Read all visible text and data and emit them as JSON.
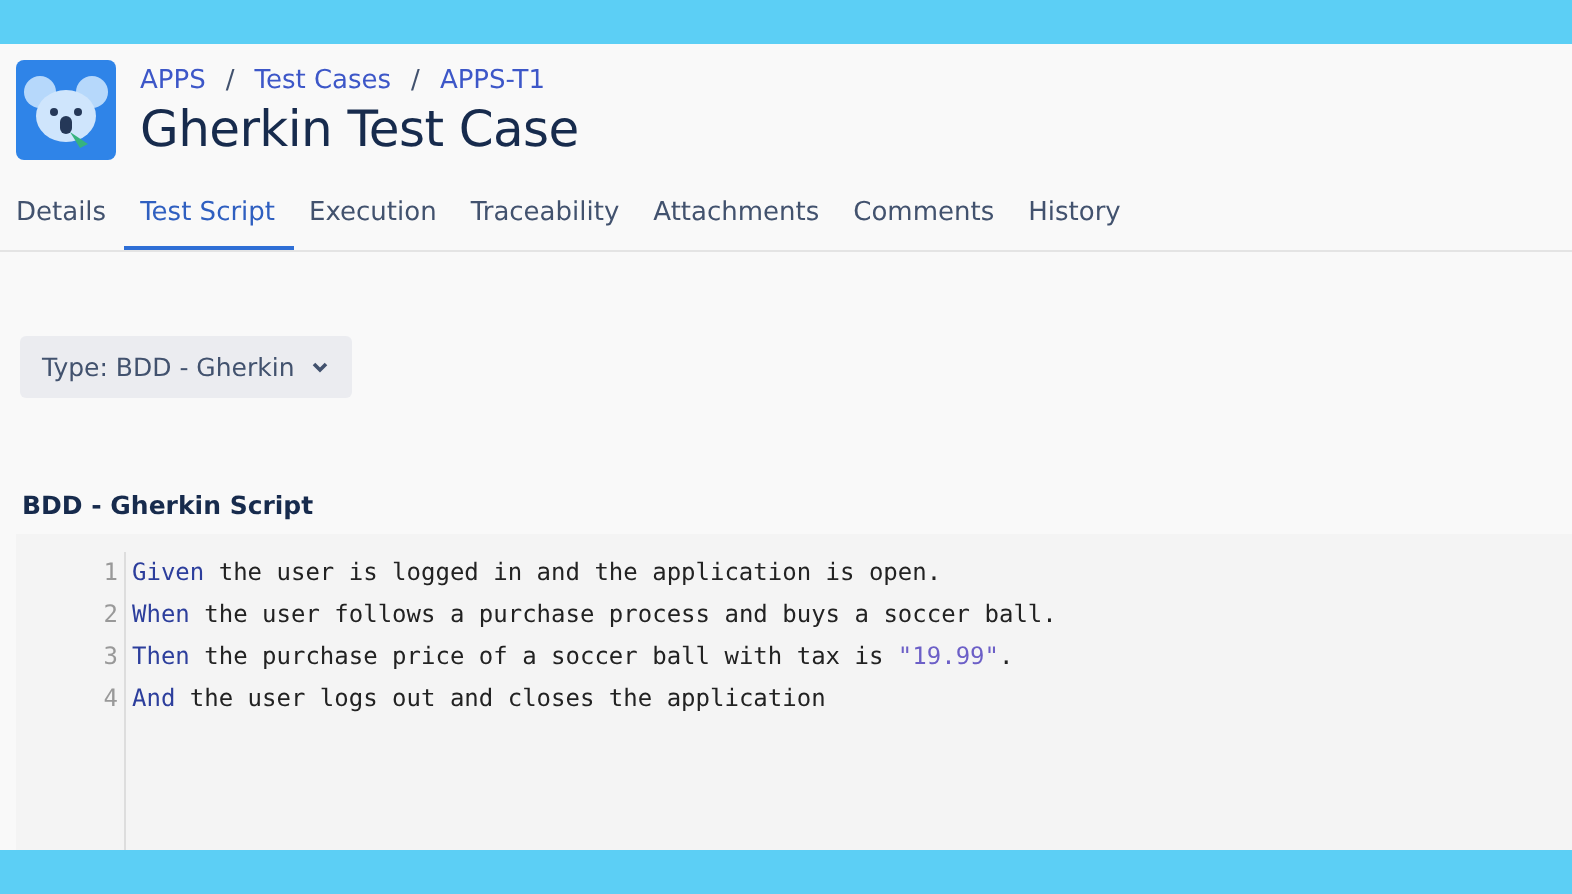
{
  "breadcrumb": [
    {
      "kind": "link",
      "text": "APPS"
    },
    {
      "kind": "separator",
      "text": "/"
    },
    {
      "kind": "link",
      "text": "Test Cases"
    },
    {
      "kind": "separator",
      "text": "/"
    },
    {
      "kind": "link",
      "text": "APPS-T1"
    }
  ],
  "title": "Gherkin Test Case",
  "tabs": [
    {
      "label": "Details",
      "selected": false
    },
    {
      "label": "Test Script",
      "selected": true
    },
    {
      "label": "Execution",
      "selected": false
    },
    {
      "label": "Traceability",
      "selected": false
    },
    {
      "label": "Attachments",
      "selected": false
    },
    {
      "label": "Comments",
      "selected": false
    },
    {
      "label": "History",
      "selected": false
    }
  ],
  "type_dropdown": {
    "label": "Type: BDD - Gherkin"
  },
  "script": {
    "heading": "BDD - Gherkin Script",
    "lines": [
      {
        "number": "1",
        "tokens": [
          {
            "kind": "keyword",
            "text": "Given"
          },
          {
            "kind": "plain",
            "text": " the user is logged in and the application is open."
          }
        ]
      },
      {
        "number": "2",
        "tokens": [
          {
            "kind": "keyword",
            "text": "When"
          },
          {
            "kind": "plain",
            "text": " the user follows a purchase process and buys a soccer ball."
          }
        ]
      },
      {
        "number": "3",
        "tokens": [
          {
            "kind": "keyword",
            "text": "Then"
          },
          {
            "kind": "plain",
            "text": " the purchase price of a soccer ball with tax is "
          },
          {
            "kind": "string",
            "text": "\"19.99\""
          },
          {
            "kind": "plain",
            "text": "."
          }
        ]
      },
      {
        "number": "4",
        "tokens": [
          {
            "kind": "keyword",
            "text": "And"
          },
          {
            "kind": "plain",
            "text": " the user logs out and closes the application"
          }
        ]
      }
    ]
  }
}
